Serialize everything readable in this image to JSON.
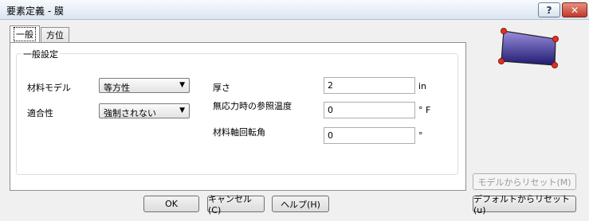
{
  "window": {
    "title": "要素定義 - 膜",
    "help_glyph": "?",
    "close_glyph": "✕"
  },
  "tabs": [
    {
      "label": "一般"
    },
    {
      "label": "方位"
    }
  ],
  "general_settings": {
    "group_title": "一般設定",
    "material_model": {
      "label": "材料モデル",
      "value": "等方性"
    },
    "compatibility": {
      "label": "適合性",
      "value": "強制されない"
    },
    "thickness": {
      "label": "厚さ",
      "value": "2",
      "unit": "in"
    },
    "stress_free_ref_temp": {
      "label": "無応力時の参照温度",
      "value": "0",
      "unit": "° F"
    },
    "material_axis_rotation": {
      "label": "材料軸回転角",
      "value": "0",
      "unit": "°"
    }
  },
  "buttons": {
    "ok": "OK",
    "cancel": "キャンセル(C)",
    "help": "ヘルプ(H)",
    "reset_from_model": "モデルからリセット(M)",
    "reset_from_default": "デフォルトからリセット(u)"
  },
  "colors": {
    "preview_fill_top": "#9b8ee0",
    "preview_fill_bottom": "#1f1a6e",
    "preview_node": "#e0301e"
  }
}
